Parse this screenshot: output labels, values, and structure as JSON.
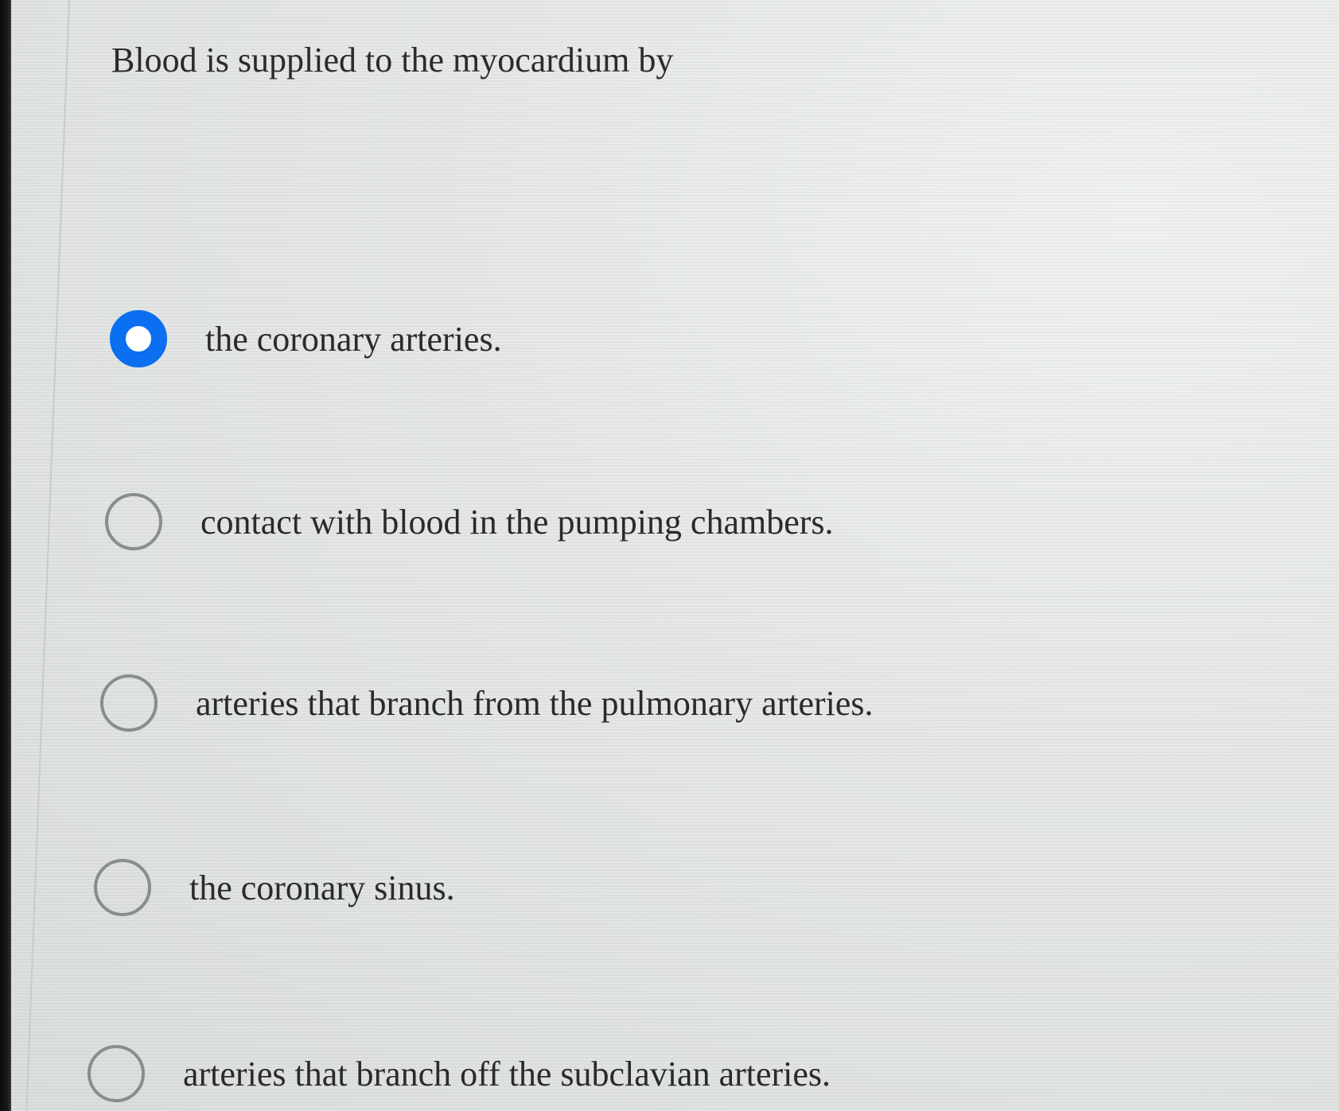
{
  "question": {
    "text": "Blood is supplied to the myocardium by"
  },
  "options": [
    {
      "label": "the coronary arteries.",
      "selected": true
    },
    {
      "label": "contact with blood in the pumping chambers.",
      "selected": false
    },
    {
      "label": "arteries that branch from the pulmonary arteries.",
      "selected": false
    },
    {
      "label": "the coronary sinus.",
      "selected": false
    },
    {
      "label": "arteries that branch off the subclavian arteries.",
      "selected": false
    }
  ],
  "colors": {
    "selected_radio": "#0a6ff0",
    "unselected_radio": "#8a8d8e",
    "text": "#2a2a2a"
  }
}
